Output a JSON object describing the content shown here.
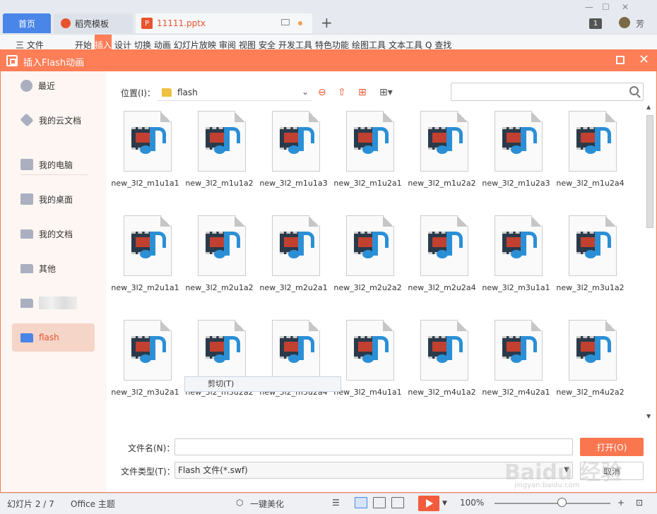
{
  "app": {
    "home_tab": "首页",
    "template_tab": "稻壳模板",
    "doc_tab": "11111.pptx",
    "new_tab_symbol": "+",
    "page_count_badge": "1",
    "user_name": "芳",
    "ribbon_items": [
      "三 文件",
      "开始",
      "插入",
      "设计",
      "切换",
      "动画",
      "幻灯片放映",
      "审阅",
      "视图",
      "安全",
      "开发工具",
      "特色功能",
      "绘图工具",
      "文本工具",
      "Q 查找"
    ]
  },
  "dialog": {
    "title": "插入Flash动画",
    "location_label": "位置(I)：",
    "location_value": "flash",
    "search_placeholder": "",
    "sidebar": [
      {
        "label": "最近",
        "icon": "clock-icon"
      },
      {
        "label": "我的云文档",
        "icon": "cloud-doc-icon"
      },
      {
        "label": "我的电脑",
        "icon": "computer-icon"
      },
      {
        "label": "我的桌面",
        "icon": "desktop-icon"
      },
      {
        "label": "我的文档",
        "icon": "folder-icon"
      },
      {
        "label": "其他",
        "icon": "folder-icon"
      },
      {
        "label": "",
        "icon": "folder-icon"
      },
      {
        "label": "flash",
        "icon": "folder-icon"
      }
    ],
    "files": [
      "new_3l2_m1u1a1",
      "new_3l2_m1u1a2",
      "new_3l2_m1u1a3",
      "new_3l2_m1u2a1",
      "new_3l2_m1u2a2",
      "new_3l2_m1u2a3",
      "new_3l2_m1u2a4",
      "new_3l2_m2u1a1",
      "new_3l2_m2u1a2",
      "new_3l2_m2u2a1",
      "new_3l2_m2u2a2",
      "new_3l2_m2u2a4",
      "new_3l2_m3u1a1",
      "new_3l2_m3u1a2",
      "new_3l2_m3u2a1",
      "new_3l2_m3u2a2",
      "new_3l2_m3u2a4",
      "new_3l2_m4u1a1",
      "new_3l2_m4u1a2",
      "new_3l2_m4u2a1",
      "new_3l2_m4u2a2"
    ],
    "context_menu_item": "剪切(T)",
    "filename_label": "文件名(N)：",
    "filename_value": "",
    "filetype_label": "文件类型(T)：",
    "filetype_value": "Flash 文件(*.swf)",
    "open_button": "打开(O)",
    "cancel_button": "取消"
  },
  "status": {
    "slide_info": "幻灯片 2 / 7",
    "theme": "Office 主题",
    "beautify": "一键美化",
    "zoom": "100%",
    "zoom_minus": "—",
    "zoom_plus": "+"
  },
  "watermark": {
    "main": "Baidu 经验",
    "sub": "jingyan.baidu.com"
  },
  "colors": {
    "accent": "#fe7e57",
    "home_tab": "#4a86e8",
    "open_button": "#f9764f"
  }
}
